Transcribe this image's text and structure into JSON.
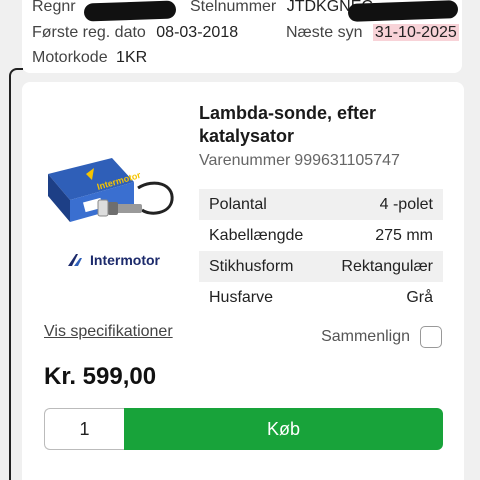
{
  "vehicle": {
    "reg_label": "Regnr",
    "vin_label": "Stelnummer",
    "vin_value": "JTDKGNEC",
    "first_reg_label": "Første reg. dato",
    "first_reg_value": "08-03-2018",
    "next_inspection_label": "Næste syn",
    "next_inspection_value": "31-10-2025",
    "engine_label": "Motorkode",
    "engine_value": "1KR"
  },
  "product": {
    "title": "Lambda-sonde, efter katalysator",
    "sku_label": "Varenummer",
    "sku_value": "999631105747",
    "brand": "Intermotor",
    "image_icon": "oxygen-sensor-product-image",
    "specs": [
      {
        "label": "Polantal",
        "value": "4 -polet"
      },
      {
        "label": "Kabellængde",
        "value": "275 mm"
      },
      {
        "label": "Stikhusform",
        "value": "Rektangulær"
      },
      {
        "label": "Husfarve",
        "value": "Grå"
      }
    ],
    "specs_link": "Vis specifikationer",
    "compare_label": "Sammenlign",
    "price": "Kr. 599,00",
    "quantity": "1",
    "buy_label": "Køb"
  },
  "colors": {
    "buy_button": "#18a33a",
    "highlight": "#f8d3d8",
    "brand_blue": "#1c2a6b"
  }
}
